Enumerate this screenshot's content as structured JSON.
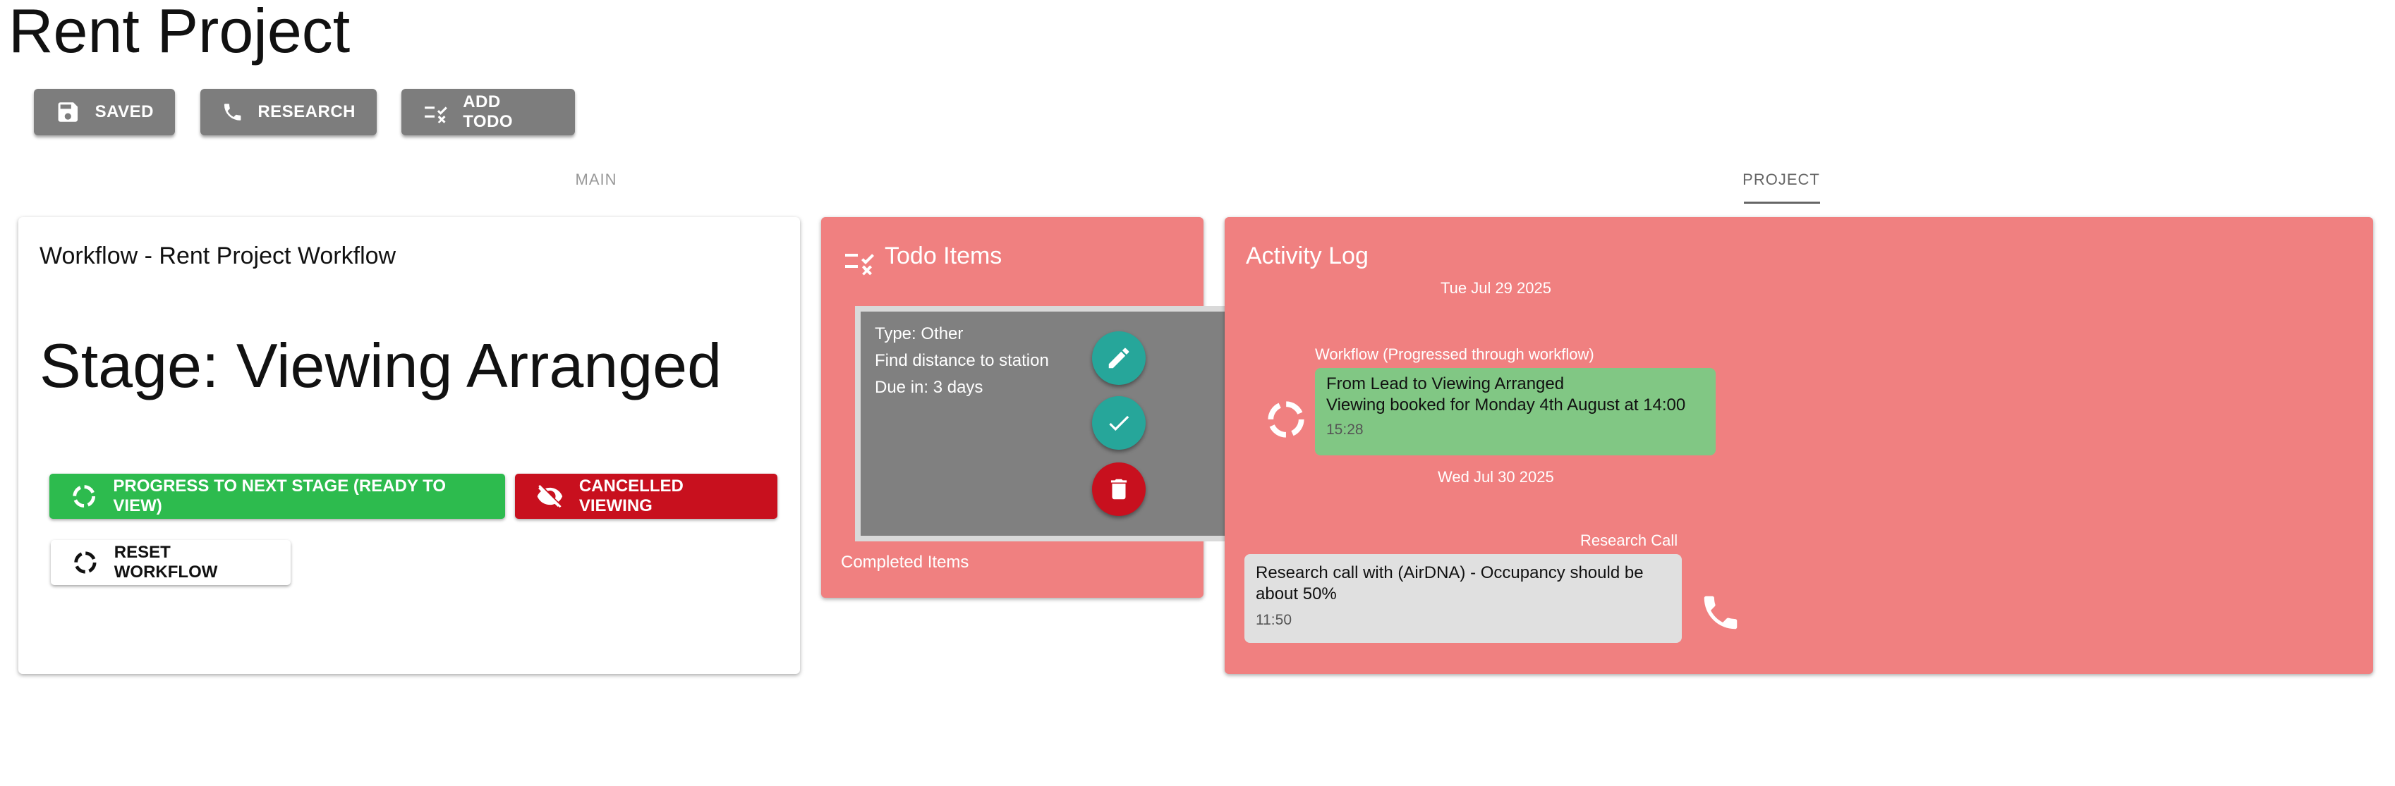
{
  "page": {
    "title": "Rent Project"
  },
  "toolbar": {
    "saved_label": "SAVED",
    "research_label": "RESEARCH",
    "add_todo_label": "ADD TODO"
  },
  "tabs": [
    {
      "label": "MAIN",
      "active": false
    },
    {
      "label": "PROJECT",
      "active": true
    }
  ],
  "workflow": {
    "title": "Workflow - Rent Project Workflow",
    "stage": "Stage: Viewing Arranged",
    "progress_label": "PROGRESS TO NEXT STAGE (READY TO VIEW)",
    "cancel_label": "CANCELLED VIEWING",
    "reset_label": "RESET WORKFLOW"
  },
  "todo": {
    "title": "Todo Items",
    "items": [
      {
        "type": "Type: Other",
        "text": "Find distance to station",
        "due": "Due in: 3 days"
      }
    ],
    "completed_label": "Completed Items"
  },
  "activity": {
    "title": "Activity Log",
    "groups": [
      {
        "date": "Tue Jul 29 2025",
        "entries": [
          {
            "label": "Workflow (Progressed through workflow)",
            "line1": "From Lead to Viewing Arranged",
            "line2": "Viewing booked for Monday 4th August at 14:00",
            "time": "15:28",
            "icon": "workflow-ring-icon"
          }
        ]
      },
      {
        "date": "Wed Jul 30 2025",
        "entries": [
          {
            "label": "Research Call",
            "line1": "Research call with (AirDNA) - Occupancy should be",
            "line2": "about 50%",
            "time": "11:50",
            "icon": "phone-icon"
          }
        ]
      }
    ]
  },
  "colors": {
    "card_red": "#f08080",
    "button_grey": "#7d7d7d",
    "progress_green": "#2dbb4e",
    "cancel_red": "#c8101e",
    "fab_teal": "#26a69a",
    "fab_red": "#c8101e",
    "bubble_green": "#81c784",
    "bubble_grey": "#e0e0e0"
  }
}
